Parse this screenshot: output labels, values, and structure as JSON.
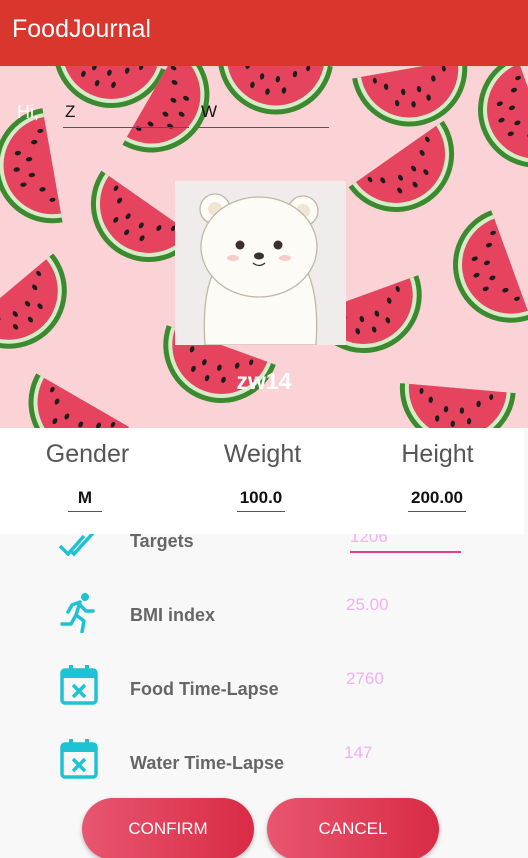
{
  "app": {
    "title": "FoodJournal"
  },
  "profile": {
    "greeting": "Hi,",
    "first_name": "Z",
    "last_name": "W",
    "username": "zw14"
  },
  "stats": [
    {
      "label": "Gender",
      "value": "M"
    },
    {
      "label": "Weight",
      "value": "100.0"
    },
    {
      "label": "Height",
      "value": "200.00"
    }
  ],
  "rows": [
    {
      "label": "Targets",
      "value": "1206",
      "icon": "double-check-icon"
    },
    {
      "label": "BMI index",
      "value": "25.00",
      "icon": "running-icon"
    },
    {
      "label": "Food Time-Lapse",
      "value": "2760",
      "icon": "calendar-x-icon"
    },
    {
      "label": "Water Time-Lapse",
      "value": "147",
      "icon": "calendar-x-icon"
    }
  ],
  "buttons": {
    "confirm": "CONFIRM",
    "cancel": "CANCEL"
  },
  "colors": {
    "appbar": "#d9372e",
    "accent": "#e83e8c",
    "icon": "#1ec3d3",
    "button": "#dd3a55"
  }
}
